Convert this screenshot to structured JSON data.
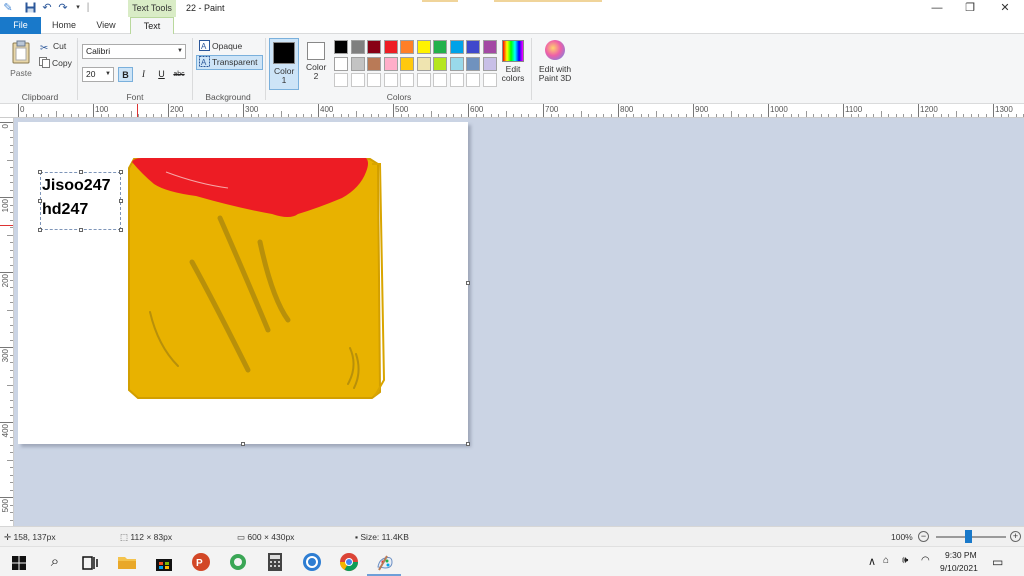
{
  "titlebar": {
    "context_tab": "Text Tools",
    "title": "22 - Paint",
    "minimize": "—",
    "restore": "❐",
    "close": "✕",
    "qa_icons": [
      "paint-app-icon",
      "save-icon",
      "undo-icon",
      "redo-icon",
      "customize-quick-access-icon"
    ]
  },
  "tabs": {
    "file": "File",
    "home": "Home",
    "view": "View",
    "text": "Text"
  },
  "ribbon": {
    "clipboard": {
      "label": "Clipboard",
      "paste": "Paste",
      "cut": "Cut",
      "copy": "Copy"
    },
    "font": {
      "label": "Font",
      "family": "Calibri",
      "size": "20",
      "bold": "B",
      "italic": "I",
      "underline": "U",
      "strikethrough": "abc"
    },
    "background": {
      "label": "Background",
      "opaque": "Opaque",
      "transparent": "Transparent"
    },
    "colors": {
      "label": "Colors",
      "color1": "Color 1",
      "color2": "Color 2",
      "color1_value": "#000000",
      "color2_value": "#ffffff",
      "edit_colors": "Edit colors",
      "palette": [
        "#000000",
        "#7f7f7f",
        "#880015",
        "#ed1c24",
        "#ff7f27",
        "#fff200",
        "#22b14c",
        "#00a2e8",
        "#3f48cc",
        "#a349a4",
        "#ffffff",
        "#c3c3c3",
        "#b97a57",
        "#ffaec9",
        "#ffc90e",
        "#efe4b0",
        "#b5e61d",
        "#99d9ea",
        "#7092be",
        "#c8bfe7",
        "#ffffff",
        "#ffffff",
        "#ffffff",
        "#ffffff",
        "#ffffff",
        "#ffffff",
        "#ffffff",
        "#ffffff",
        "#ffffff",
        "#ffffff"
      ]
    },
    "paint3d": "Edit with Paint 3D"
  },
  "ruler": {
    "h_ticks": [
      "0",
      "100",
      "200",
      "300",
      "400",
      "500",
      "600",
      "700",
      "800",
      "900",
      "1000",
      "1100",
      "1200",
      "1300"
    ],
    "v_ticks": [
      "0",
      "100",
      "200",
      "300",
      "400",
      "500"
    ]
  },
  "canvas": {
    "text_line1": "Jisoo247",
    "text_line2": "hd247",
    "drawing_colors": {
      "box": "#e8b200",
      "lid": "#ed1c24",
      "streaks": "#b8900a"
    }
  },
  "status": {
    "cursor_pos": "158, 137px",
    "selection_size": "112 × 83px",
    "canvas_size": "600 × 430px",
    "file_size": "Size: 11.4KB",
    "zoom": "100%",
    "zoom_out": "−",
    "zoom_in": "+"
  },
  "taskbar": {
    "apps": [
      "start-icon",
      "search-icon",
      "task-view-icon",
      "file-explorer-icon",
      "store-icon",
      "powerpoint-icon",
      "app-icon",
      "calculator-icon",
      "app-icon",
      "chrome-icon",
      "paint-icon"
    ],
    "tray_chevron": "∧",
    "time": "9:30 PM",
    "date": "9/10/2021"
  }
}
